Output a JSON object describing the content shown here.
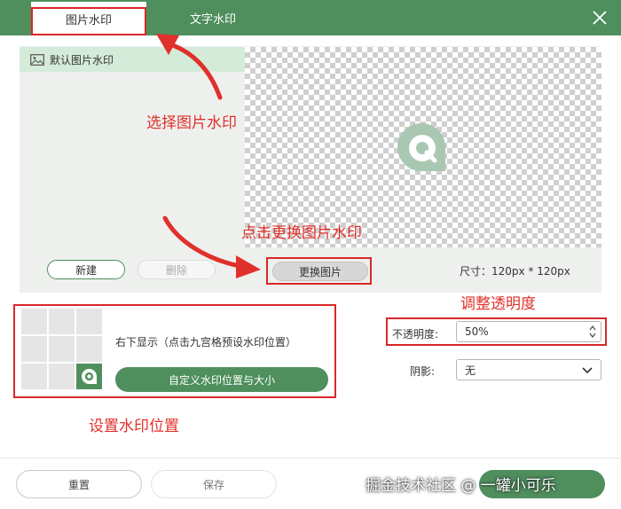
{
  "tabs": [
    {
      "label": "图片水印",
      "active": true
    },
    {
      "label": "文字水印",
      "active": false
    }
  ],
  "image_list": {
    "items": [
      {
        "label": "默认图片水印",
        "selected": true
      }
    ]
  },
  "buttons": {
    "new": "新建",
    "delete": "删除",
    "replace_image": "更换图片",
    "custom_position": "自定义水印位置与大小",
    "reset": "重置",
    "save": "保存"
  },
  "image_size": "尺寸：120px * 120px",
  "position": {
    "description": "右下显示（点击九宫格预设水印位置）",
    "selected_cell": "bottom-right"
  },
  "opacity": {
    "label": "不透明度:",
    "value": "50%"
  },
  "shadow": {
    "label": "阴影:",
    "value": "无"
  },
  "annotations": {
    "select_image": "选择图片水印",
    "replace_image": "点击更换图片水印",
    "adjust_opacity": "调整透明度",
    "set_position": "设置水印位置"
  },
  "site_watermark": "掘金技术社区 @ 一罐小可乐",
  "colors": {
    "brand_green": "#4f8f5e",
    "annotation_red": "#e0302a",
    "selected_light_green": "#d5ebd9"
  },
  "icons": {
    "close": "close-icon",
    "image": "image-icon",
    "logo": "watermark-logo-icon",
    "chevron": "chevron-down-icon",
    "spinner": "spinner-arrows-icon"
  }
}
